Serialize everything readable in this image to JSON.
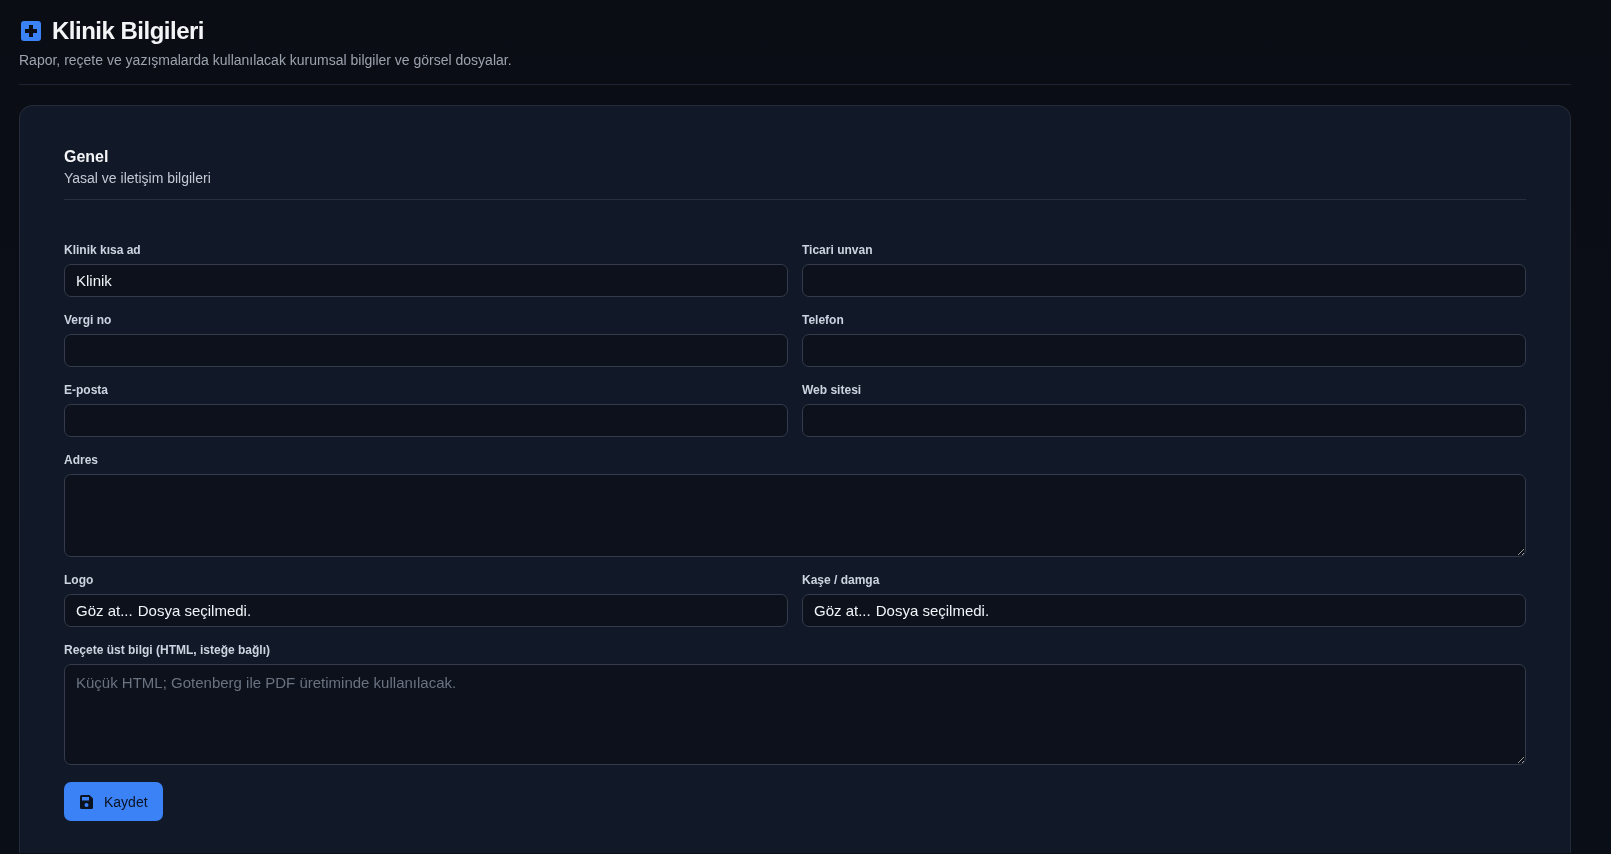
{
  "header": {
    "title": "Klinik Bilgileri",
    "subtitle": "Rapor, reçete ve yazışmalarda kullanılacak kurumsal bilgiler ve görsel dosyalar."
  },
  "section": {
    "title": "Genel",
    "subtitle": "Yasal ve iletişim bilgileri"
  },
  "fields": [
    {
      "kind": "text",
      "label": "Klinik kısa ad",
      "value": "Klinik"
    },
    {
      "kind": "text",
      "label": "Ticari unvan"
    },
    {
      "kind": "text",
      "label": "Vergi no"
    },
    {
      "kind": "text",
      "label": "Telefon"
    },
    {
      "kind": "text",
      "label": "E-posta"
    },
    {
      "kind": "text",
      "label": "Web sitesi"
    },
    {
      "kind": "textarea",
      "label": "Adres"
    },
    {
      "kind": "file",
      "label": "Logo",
      "button": "Göz at...",
      "status": "Dosya seçilmedi."
    },
    {
      "kind": "file",
      "label": "Kaşe / damga",
      "button": "Göz at...",
      "status": "Dosya seçilmedi."
    },
    {
      "kind": "textarea",
      "label": "Reçete üst bilgi (HTML, isteğe bağlı)",
      "placeholder": "Küçük HTML; Gotenberg ile PDF üretiminde kullanılacak."
    }
  ],
  "save_button": {
    "label": "Kaydet"
  }
}
